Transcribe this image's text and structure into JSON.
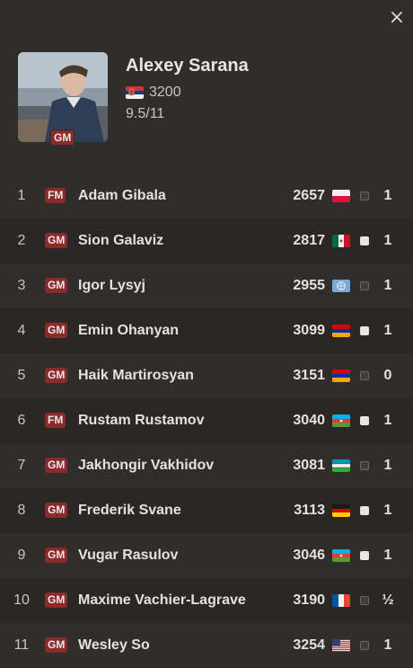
{
  "close_label": "×",
  "player": {
    "name": "Alexey Sarana",
    "title": "GM",
    "rating": "3200",
    "flag": "serbia-flag",
    "score": "9.5/11"
  },
  "colors": {
    "background": "#302e2b",
    "row_alt": "#2a2826",
    "title_badge": "#8a2a2b"
  },
  "games": [
    {
      "round": "1",
      "title": "FM",
      "name": "Adam Gibala",
      "rating": "2657",
      "flag": "poland-flag",
      "color": "black",
      "result": "1"
    },
    {
      "round": "2",
      "title": "GM",
      "name": "Sion Galaviz",
      "rating": "2817",
      "flag": "mexico-flag",
      "color": "white",
      "result": "1"
    },
    {
      "round": "3",
      "title": "GM",
      "name": "Igor Lysyj",
      "rating": "2955",
      "flag": "international-flag",
      "color": "black",
      "result": "1"
    },
    {
      "round": "4",
      "title": "GM",
      "name": "Emin Ohanyan",
      "rating": "3099",
      "flag": "armenia-flag",
      "color": "white",
      "result": "1"
    },
    {
      "round": "5",
      "title": "GM",
      "name": "Haik Martirosyan",
      "rating": "3151",
      "flag": "armenia-flag",
      "color": "black",
      "result": "0"
    },
    {
      "round": "6",
      "title": "FM",
      "name": "Rustam Rustamov",
      "rating": "3040",
      "flag": "azerbaijan-flag",
      "color": "white",
      "result": "1"
    },
    {
      "round": "7",
      "title": "GM",
      "name": "Jakhongir Vakhidov",
      "rating": "3081",
      "flag": "uzbekistan-flag",
      "color": "black",
      "result": "1"
    },
    {
      "round": "8",
      "title": "GM",
      "name": "Frederik Svane",
      "rating": "3113",
      "flag": "germany-flag",
      "color": "white",
      "result": "1"
    },
    {
      "round": "9",
      "title": "GM",
      "name": "Vugar Rasulov",
      "rating": "3046",
      "flag": "azerbaijan-flag",
      "color": "white",
      "result": "1"
    },
    {
      "round": "10",
      "title": "GM",
      "name": "Maxime Vachier-Lagrave",
      "rating": "3190",
      "flag": "france-flag",
      "color": "black",
      "result": "½"
    },
    {
      "round": "11",
      "title": "GM",
      "name": "Wesley So",
      "rating": "3254",
      "flag": "usa-flag",
      "color": "black",
      "result": "1"
    }
  ]
}
